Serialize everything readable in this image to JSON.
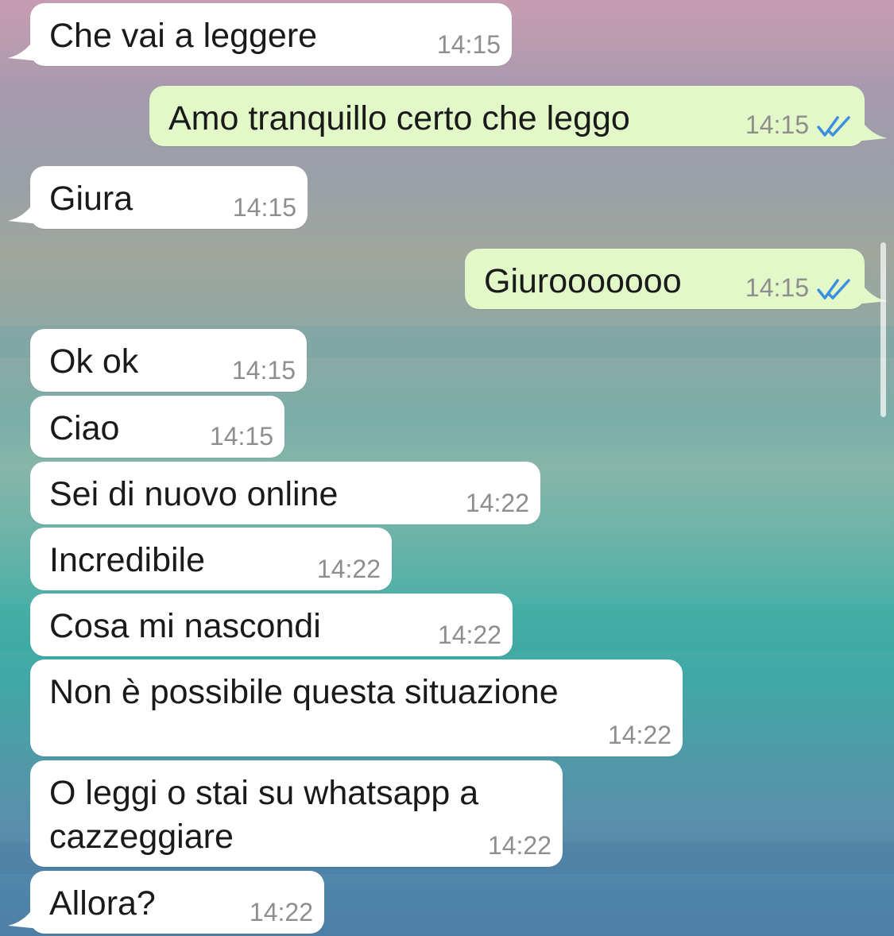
{
  "messages": [
    {
      "direction": "incoming",
      "text": "Che vai a leggere",
      "time": "14:15"
    },
    {
      "direction": "outgoing",
      "text": "Amo tranquillo certo che leggo",
      "time": "14:15",
      "status": "read"
    },
    {
      "direction": "incoming",
      "text": "Giura",
      "time": "14:15"
    },
    {
      "direction": "outgoing",
      "text": "Giurooooooo",
      "time": "14:15",
      "status": "read"
    },
    {
      "direction": "incoming",
      "text": "Ok ok",
      "time": "14:15"
    },
    {
      "direction": "incoming",
      "text": "Ciao",
      "time": "14:15"
    },
    {
      "direction": "incoming",
      "text": "Sei di nuovo online",
      "time": "14:22"
    },
    {
      "direction": "incoming",
      "text": "Incredibile",
      "time": "14:22"
    },
    {
      "direction": "incoming",
      "text": "Cosa mi nascondi",
      "time": "14:22"
    },
    {
      "direction": "incoming",
      "text": "Non è possibile questa situazione",
      "time": "14:22"
    },
    {
      "direction": "incoming",
      "text": "O leggi o stai su whatsapp a cazzeggiare",
      "time": "14:22"
    },
    {
      "direction": "incoming",
      "text": "Allora?",
      "time": "14:22"
    }
  ],
  "colors": {
    "incoming_bubble": "#ffffff",
    "outgoing_bubble": "#e2f8c8",
    "timestamp": "#8e8e8e",
    "read_ticks": "#3b8fe0"
  },
  "icons": {
    "read_status": "double-check-icon"
  }
}
